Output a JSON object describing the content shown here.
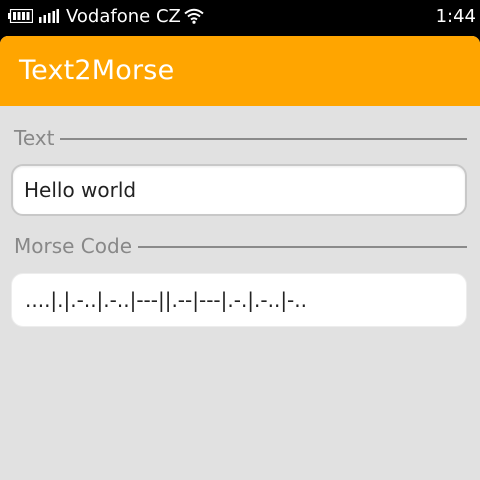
{
  "status_bar": {
    "carrier": "Vodafone CZ",
    "time": "1:44",
    "battery_icon": "battery-icon",
    "signal_icon": "signal-icon",
    "wifi_icon": "wifi-icon"
  },
  "app": {
    "title": "Text2Morse",
    "accent_color": "#ffa500",
    "text_section": {
      "label": "Text",
      "value": "Hello world"
    },
    "morse_section": {
      "label": "Morse Code",
      "value": "....|.|.-..|.-..|---||.--|---|.-.|.-..|-.."
    }
  }
}
